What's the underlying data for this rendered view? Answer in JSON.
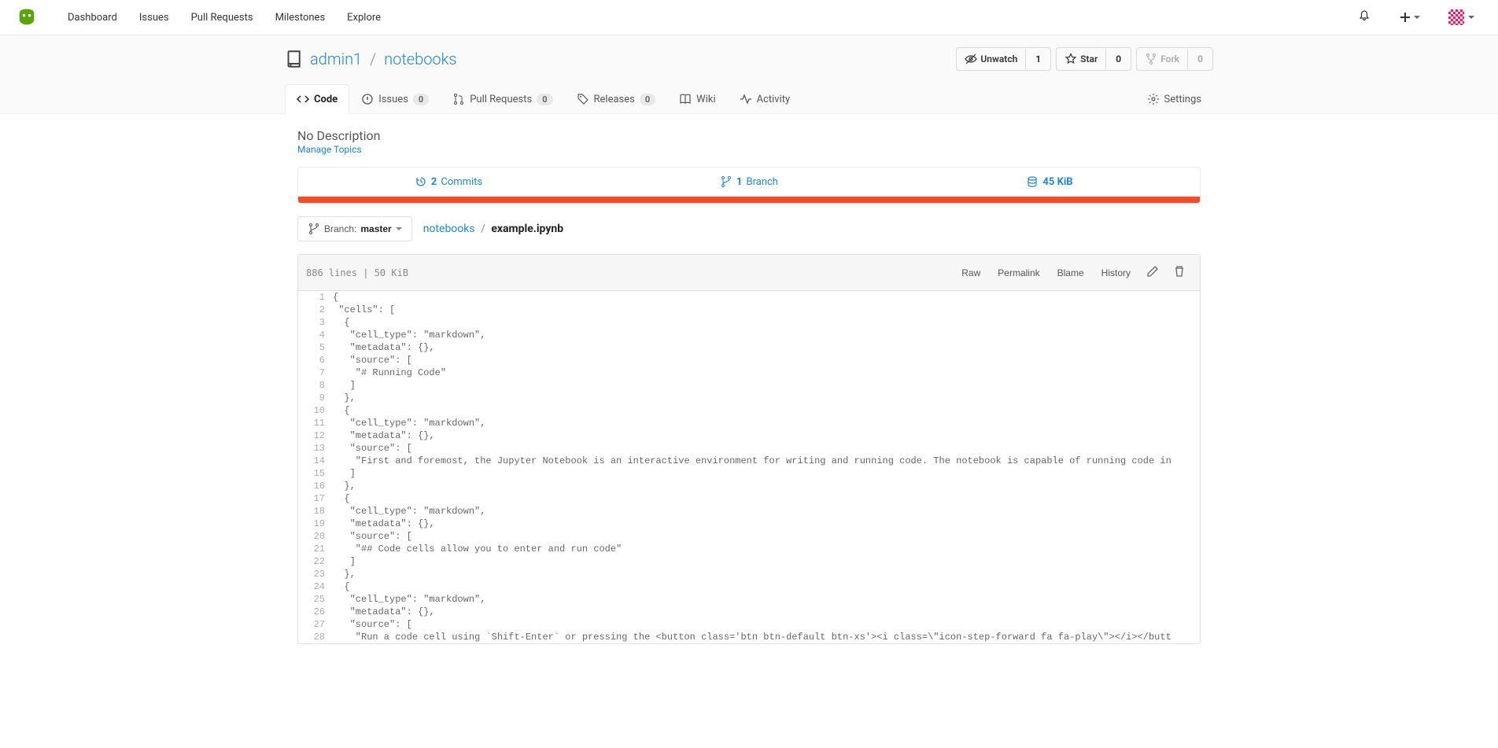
{
  "nav": {
    "items": [
      "Dashboard",
      "Issues",
      "Pull Requests",
      "Milestones",
      "Explore"
    ]
  },
  "repo": {
    "owner": "admin1",
    "name": "notebooks",
    "watch_label": "Unwatch",
    "watch_count": "1",
    "star_label": "Star",
    "star_count": "0",
    "fork_label": "Fork",
    "fork_count": "0"
  },
  "tabs": {
    "code": "Code",
    "issues": "Issues",
    "issues_count": "0",
    "pr": "Pull Requests",
    "pr_count": "0",
    "releases": "Releases",
    "releases_count": "0",
    "wiki": "Wiki",
    "activity": "Activity",
    "settings": "Settings"
  },
  "description": "No Description",
  "manage_topics": "Manage Topics",
  "stats": {
    "commits_count": "2",
    "commits_label": " Commits",
    "branch_count": "1",
    "branch_label": " Branch",
    "size": "45 KiB"
  },
  "branch": {
    "label": "Branch: ",
    "name": "master"
  },
  "breadcrumb": {
    "root": "notebooks",
    "current": "example.ipynb"
  },
  "file_meta": "886 lines | 50 KiB",
  "file_actions": {
    "raw": "Raw",
    "permalink": "Permalink",
    "blame": "Blame",
    "history": "History"
  },
  "code_lines": [
    "{",
    " \"cells\": [",
    "  {",
    "   \"cell_type\": \"markdown\",",
    "   \"metadata\": {},",
    "   \"source\": [",
    "    \"# Running Code\"",
    "   ]",
    "  },",
    "  {",
    "   \"cell_type\": \"markdown\",",
    "   \"metadata\": {},",
    "   \"source\": [",
    "    \"First and foremost, the Jupyter Notebook is an interactive environment for writing and running code. The notebook is capable of running code in",
    "   ]",
    "  },",
    "  {",
    "   \"cell_type\": \"markdown\",",
    "   \"metadata\": {},",
    "   \"source\": [",
    "    \"## Code cells allow you to enter and run code\"",
    "   ]",
    "  },",
    "  {",
    "   \"cell_type\": \"markdown\",",
    "   \"metadata\": {},",
    "   \"source\": [",
    "    \"Run a code cell using `Shift-Enter` or pressing the <button class='btn btn-default btn-xs'><i class=\\\"icon-step-forward fa fa-play\\\"></i></butt"
  ]
}
